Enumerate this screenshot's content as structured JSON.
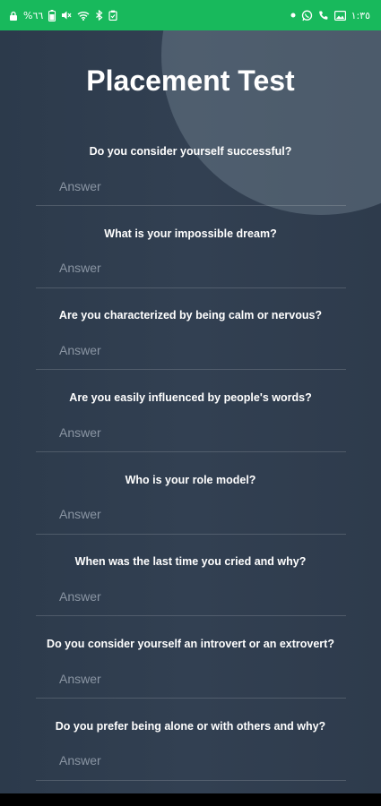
{
  "status_bar": {
    "battery_text": "%٦٦",
    "time": "١:٣٥",
    "left_icons": [
      "lock-icon",
      "battery-icon",
      "mute-icon",
      "wifi-icon",
      "bluetooth-icon",
      "clipboard-icon"
    ],
    "right_icons": [
      "dot-icon",
      "whatsapp-icon",
      "phone-icon",
      "image-icon"
    ],
    "background_color": "#18b95c"
  },
  "page": {
    "title": "Placement Test",
    "background_color": "#2f3c4d"
  },
  "questions": [
    {
      "label": "Do you consider yourself successful?",
      "placeholder": "Answer",
      "value": ""
    },
    {
      "label": "What is your impossible dream?",
      "placeholder": "Answer",
      "value": ""
    },
    {
      "label": "Are you characterized by being calm or nervous?",
      "placeholder": "Answer",
      "value": ""
    },
    {
      "label": "Are you easily influenced by people's words?",
      "placeholder": "Answer",
      "value": ""
    },
    {
      "label": "Who is your role model?",
      "placeholder": "Answer",
      "value": ""
    },
    {
      "label": "When was the last time you cried and why?",
      "placeholder": "Answer",
      "value": ""
    },
    {
      "label": "Do you consider yourself an introvert or an extrovert?",
      "placeholder": "Answer",
      "value": ""
    },
    {
      "label": "Do you prefer being alone or with others and why?",
      "placeholder": "Answer",
      "value": ""
    }
  ]
}
